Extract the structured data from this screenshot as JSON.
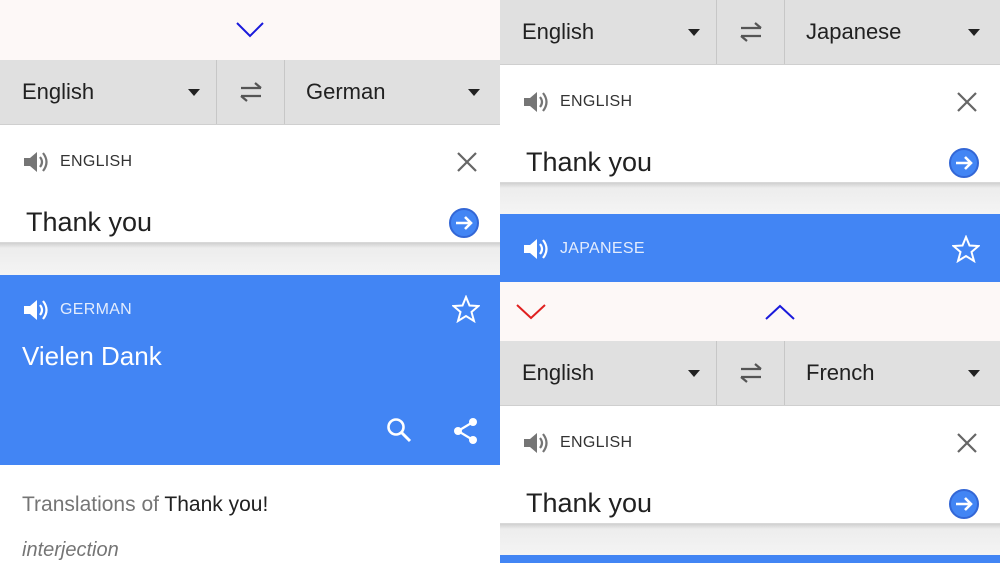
{
  "left_screen": {
    "source_language": "English",
    "target_language": "German",
    "input_lang_label": "ENGLISH",
    "input_text": "Thank you",
    "result_lang_label": "GERMAN",
    "result_text": "Vielen Dank",
    "translations_of_label": "Translations of",
    "translations_of_phrase": "Thank you!",
    "part_of_speech": "interjection"
  },
  "right_top": {
    "source_language": "English",
    "target_language": "Japanese",
    "input_lang_label": "ENGLISH",
    "input_text": "Thank you",
    "result_lang_label": "JAPANESE"
  },
  "right_bottom": {
    "source_language": "English",
    "target_language": "French",
    "input_lang_label": "ENGLISH",
    "input_text": "Thank you"
  },
  "colors": {
    "accent_blue": "#4285f4",
    "chevron_blue": "#1a1adb",
    "chevron_red": "#e02020",
    "bar_gray": "#e0e0e0"
  },
  "icons": [
    "chevron-down-icon",
    "chevron-up-icon",
    "dropdown-caret-icon",
    "swap-icon",
    "speaker-icon",
    "close-icon",
    "arrow-right-circle-icon",
    "star-icon",
    "search-icon",
    "share-icon"
  ]
}
